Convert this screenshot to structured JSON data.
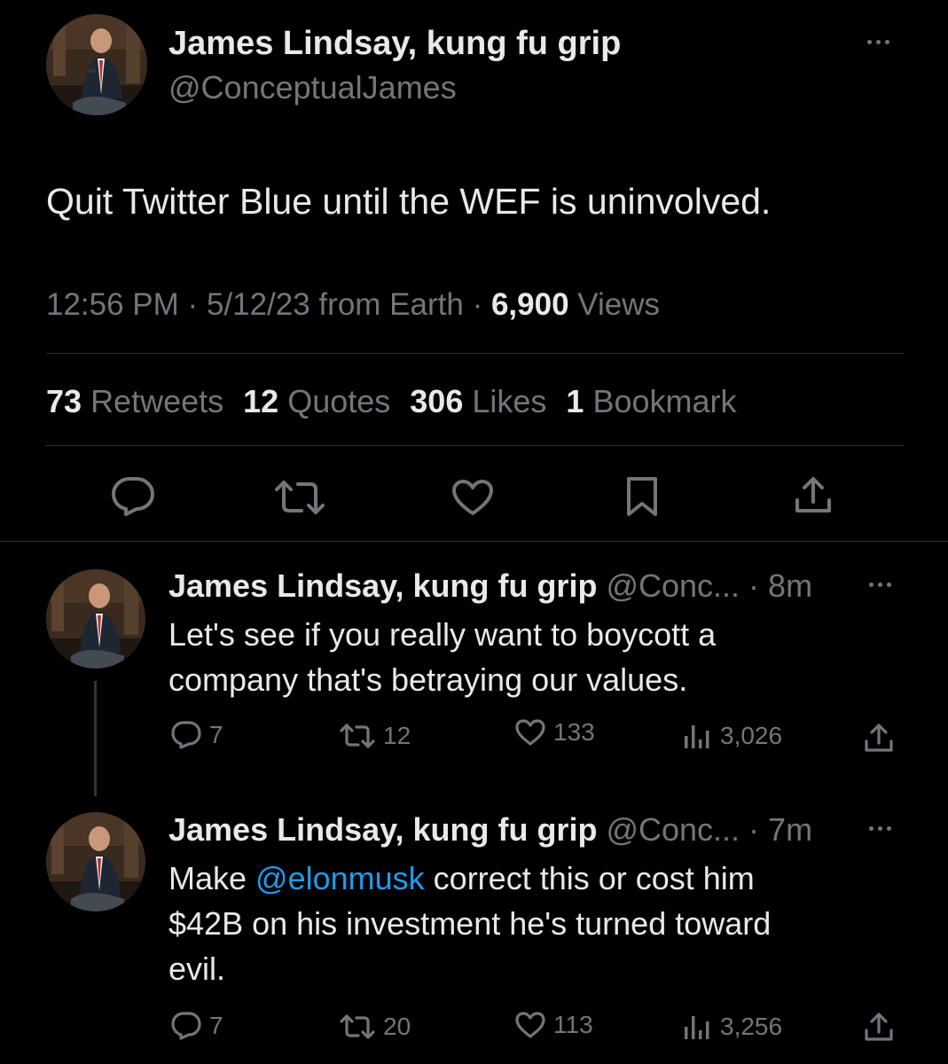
{
  "colors": {
    "background": "#000000",
    "text": "#e7e9ea",
    "muted": "#71767b",
    "divider": "#2f3336",
    "link": "#1d9bf0"
  },
  "main_tweet": {
    "author_name": "James Lindsay, kung fu grip",
    "author_handle": "@ConceptualJames",
    "text": "Quit Twitter Blue until the WEF is uninvolved.",
    "time": "12:56 PM",
    "date_source": "5/12/23 from Earth",
    "separator": "·",
    "views_count": "6,900",
    "views_label": "Views",
    "stats": {
      "retweets_count": "73",
      "retweets_label": "Retweets",
      "quotes_count": "12",
      "quotes_label": "Quotes",
      "likes_count": "306",
      "likes_label": "Likes",
      "bookmarks_count": "1",
      "bookmarks_label": "Bookmark"
    },
    "actions": [
      "reply-icon",
      "retweet-icon",
      "like-icon",
      "bookmark-icon",
      "share-icon"
    ]
  },
  "replies": [
    {
      "author_name": "James Lindsay, kung fu grip",
      "handle_truncated": "@Conc...",
      "age": "8m",
      "text_line1": "Let's see if you really want to boycott a",
      "text_line2": "company that's betraying our values.",
      "replies": "7",
      "retweets": "12",
      "likes": "133",
      "views": "3,026"
    },
    {
      "author_name": "James Lindsay, kung fu grip",
      "handle_truncated": "@Conc...",
      "age": "7m",
      "text_prefix": "Make ",
      "mention": "@elonmusk",
      "text_suffix": " correct this or cost him",
      "text_line2": "$42B on his investment he's turned toward",
      "text_line3": "evil.",
      "replies": "7",
      "retweets": "20",
      "likes": "113",
      "views": "3,256"
    }
  ]
}
